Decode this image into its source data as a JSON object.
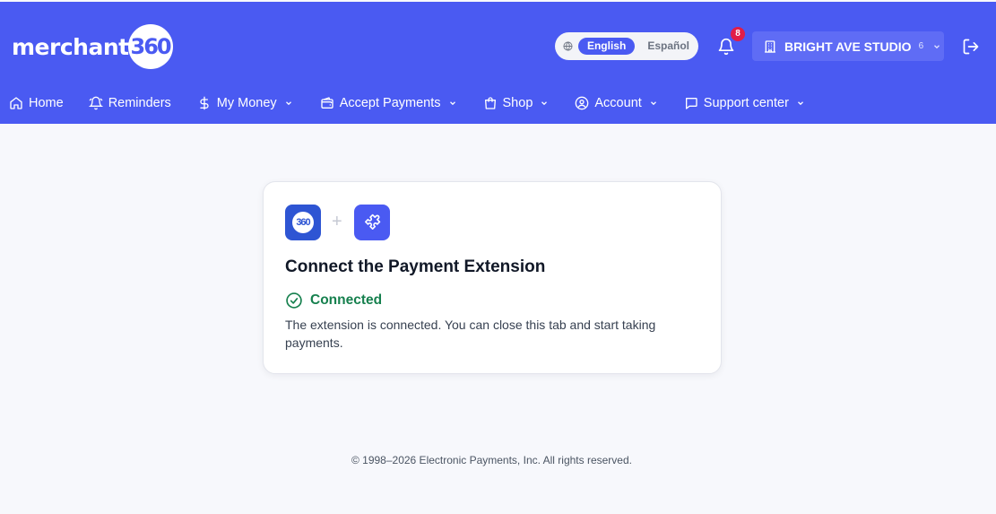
{
  "brand": {
    "wordmark": "merchant",
    "number": "360"
  },
  "language": {
    "icon": "globe-icon",
    "active": "English",
    "other": "Español"
  },
  "notifications": {
    "icon": "bell-icon",
    "count": "8"
  },
  "account_switcher": {
    "icon": "building-icon",
    "name": "BRIGHT AVE STUDIO",
    "count": "6"
  },
  "logout": {
    "icon": "logout-icon"
  },
  "nav": {
    "items": [
      {
        "label": "Home",
        "icon": "home-icon"
      },
      {
        "label": "Reminders",
        "icon": "bell-icon"
      },
      {
        "label": "My Money",
        "icon": "dollar-icon"
      },
      {
        "label": "Accept Payments",
        "icon": "wallet-icon"
      },
      {
        "label": "Shop",
        "icon": "shopping-bag-icon"
      },
      {
        "label": "Account",
        "icon": "user-circle-icon"
      },
      {
        "label": "Support center",
        "icon": "chat-icon"
      }
    ]
  },
  "card": {
    "logo_badge_text": "360",
    "plus": "+",
    "extension_icon": "puzzle-icon",
    "title": "Connect the Payment Extension",
    "status_icon": "check-circle-icon",
    "status": "Connected",
    "description": "The extension is connected. You can close this tab and start taking payments."
  },
  "footer": {
    "text": "© 1998–2026 Electronic Payments, Inc. All rights reserved."
  },
  "colors": {
    "brand": "#4a5af2",
    "success": "#16804e",
    "badge": "#e11d48"
  }
}
